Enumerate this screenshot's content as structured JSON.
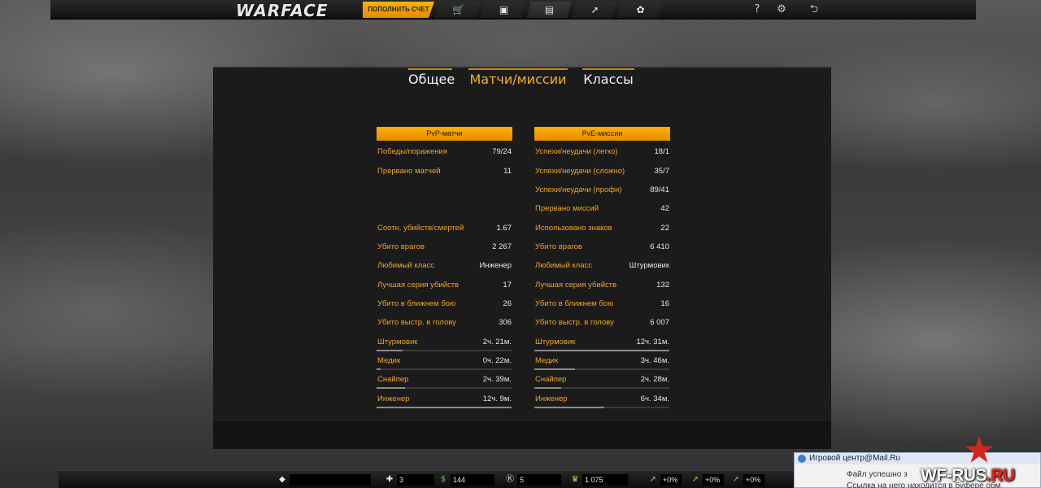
{
  "topbar": {
    "logo": "WARFACE",
    "topup_label": "ПОПОЛНИТЬ СЧЕТ",
    "nav_icons": [
      "cart-icon",
      "inventory-icon",
      "stats-icon",
      "trend-icon",
      "achievements-icon"
    ],
    "help": "?",
    "settings": "⚙",
    "exit": "⮌"
  },
  "tabs": [
    {
      "label": "Общее",
      "active": false
    },
    {
      "label": "Матчи/миссии",
      "active": true
    },
    {
      "label": "Классы",
      "active": false
    }
  ],
  "pvp": {
    "title": "PvP-матчи",
    "rows": [
      {
        "label": "Победы/поражения",
        "value": "79/24"
      },
      {
        "label": "Прервано матчей",
        "value": "11"
      },
      {
        "label": "Соотн. убийств/смертей",
        "value": "1.67"
      },
      {
        "label": "Убито врагов",
        "value": "2 267"
      },
      {
        "label": "Любимый класс",
        "value": "Инженер"
      },
      {
        "label": "Лучшая серия убийств",
        "value": "17"
      },
      {
        "label": "Убито в ближнем бою",
        "value": "26"
      },
      {
        "label": "Убито выстр. в голову",
        "value": "306"
      }
    ],
    "classes": [
      {
        "label": "Штурмовик",
        "value": "2ч. 21м.",
        "fill": 0.19
      },
      {
        "label": "Медик",
        "value": "0ч. 22м.",
        "fill": 0.03
      },
      {
        "label": "Снайпер",
        "value": "2ч. 39м.",
        "fill": 0.21
      },
      {
        "label": "Инженер",
        "value": "12ч. 9м.",
        "fill": 1.0
      }
    ]
  },
  "pve": {
    "title": "PvE-миссии",
    "rows": [
      {
        "label": "Успехи/неудачи (легко)",
        "value": "18/1"
      },
      {
        "label": "Успехи/неудачи (сложно)",
        "value": "35/7"
      },
      {
        "label": "Успехи/неудачи (профи)",
        "value": "89/41"
      },
      {
        "label": "Прервано миссий",
        "value": "42"
      },
      {
        "label": "Использовано знаков",
        "value": "22"
      },
      {
        "label": "Убито врагов",
        "value": "6 410"
      },
      {
        "label": "Любимый класс",
        "value": "Штурмовик"
      },
      {
        "label": "Лучшая серия убийств",
        "value": "132"
      },
      {
        "label": "Убито в ближнем бою",
        "value": "16"
      },
      {
        "label": "Убито выстр. в голову",
        "value": "6 007"
      }
    ],
    "classes": [
      {
        "label": "Штурмовик",
        "value": "12ч. 31м.",
        "fill": 1.0
      },
      {
        "label": "Медик",
        "value": "3ч. 46м.",
        "fill": 0.3
      },
      {
        "label": "Снайпер",
        "value": "2ч. 28м.",
        "fill": 0.2
      },
      {
        "label": "Инженер",
        "value": "6ч. 34м.",
        "fill": 0.52
      }
    ]
  },
  "bottombar": {
    "rank": "",
    "stats": [
      {
        "icon": "medkit-icon",
        "value": "3"
      },
      {
        "icon": "money-icon",
        "value": "144"
      },
      {
        "icon": "kredits-icon",
        "value": "5"
      },
      {
        "icon": "crown-icon",
        "value": "1 075"
      },
      {
        "icon": "boost-xp-icon",
        "value": "+0%"
      },
      {
        "icon": "boost-money-icon",
        "value": "+0%"
      },
      {
        "icon": "boost-vp-icon",
        "value": "+0%"
      }
    ]
  },
  "notification": {
    "title": "Игровой центр@Mail.Ru",
    "line1": "Файл успешно з",
    "line2": "Ссылка на него находится в буфере обм"
  },
  "watermark": {
    "main": "WF-RUS",
    "accent": ".RU"
  },
  "colors": {
    "accent": "#f0a526",
    "header": "#ffb000"
  }
}
